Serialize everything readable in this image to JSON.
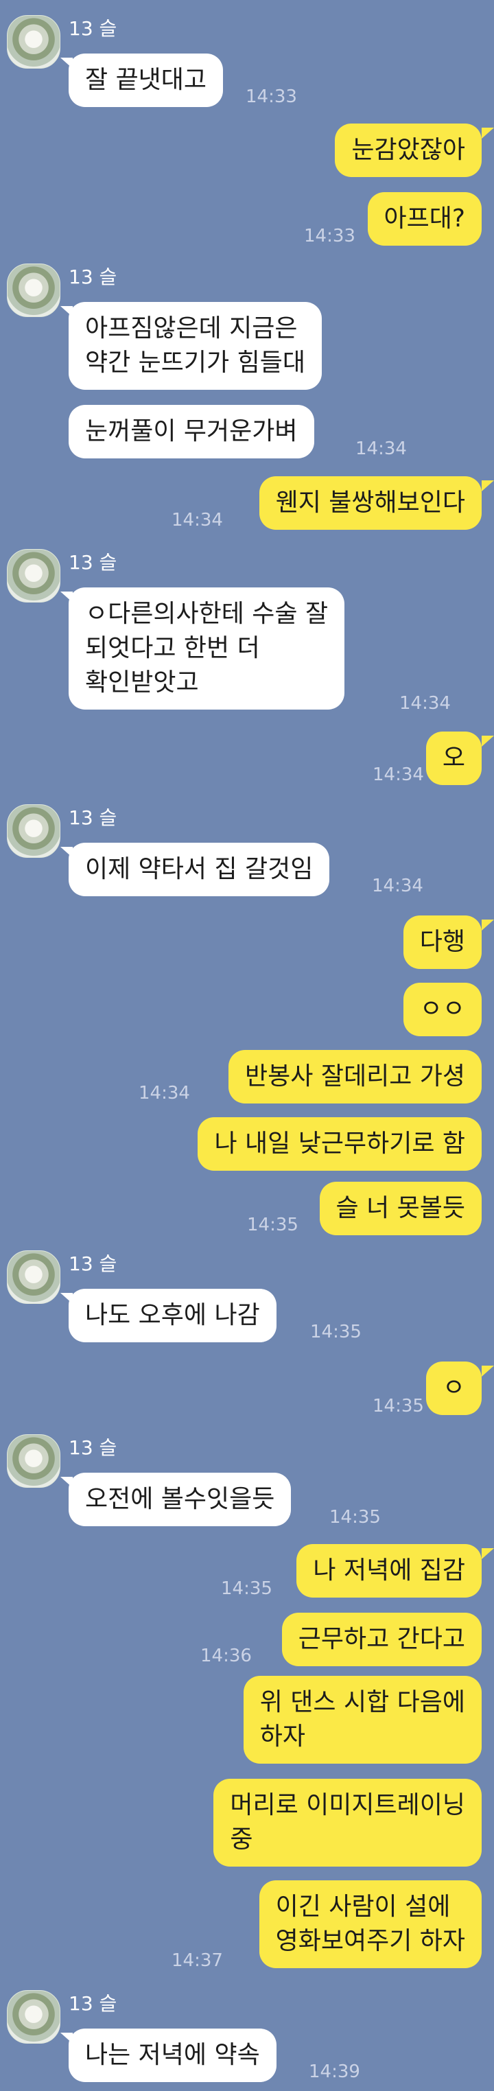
{
  "chat": {
    "sender_name": "13 슬",
    "messages": [
      {
        "from": "other",
        "text": "잘 끝냇대고",
        "time": "14:33"
      },
      {
        "from": "me",
        "text": "눈감았잖아",
        "time": ""
      },
      {
        "from": "me",
        "text": "아프대?",
        "time": "14:33"
      },
      {
        "from": "other",
        "text": "아프짐않은데 지금은\n약간 눈뜨기가 힘들대",
        "time": ""
      },
      {
        "from": "other",
        "text": "눈꺼풀이 무거운가벼",
        "time": "14:34"
      },
      {
        "from": "me",
        "text": "웬지 불쌍해보인다",
        "time": "14:34"
      },
      {
        "from": "other",
        "text": "ㅇ다른의사한테 수술 잘\n되엇다고 한번 더\n확인받앗고",
        "time": "14:34"
      },
      {
        "from": "me",
        "text": "오",
        "time": "14:34"
      },
      {
        "from": "other",
        "text": "이제 약타서 집 갈것임",
        "time": "14:34"
      },
      {
        "from": "me",
        "text": "다행",
        "time": ""
      },
      {
        "from": "me",
        "text": "ㅇㅇ",
        "time": ""
      },
      {
        "from": "me",
        "text": "반봉사 잘데리고 가셩",
        "time": "14:34"
      },
      {
        "from": "me",
        "text": "나 내일 낮근무하기로 함",
        "time": ""
      },
      {
        "from": "me",
        "text": "슬 너 못볼듯",
        "time": "14:35"
      },
      {
        "from": "other",
        "text": "나도 오후에 나감",
        "time": "14:35"
      },
      {
        "from": "me",
        "text": "ㅇ",
        "time": "14:35"
      },
      {
        "from": "other",
        "text": "오전에 볼수잇을듯",
        "time": "14:35"
      },
      {
        "from": "me",
        "text": "나 저녁에 집감",
        "time": "14:35"
      },
      {
        "from": "me",
        "text": "근무하고 간다고",
        "time": "14:36"
      },
      {
        "from": "me",
        "text": "위 댄스 시합 다음에\n하자",
        "time": ""
      },
      {
        "from": "me",
        "text": "머리로 이미지트레이닝\n중",
        "time": ""
      },
      {
        "from": "me",
        "text": "이긴 사람이 설에\n영화보여주기 하자",
        "time": "14:37"
      },
      {
        "from": "other",
        "text": "나는 저녁에 약속",
        "time": "14:39"
      }
    ]
  }
}
